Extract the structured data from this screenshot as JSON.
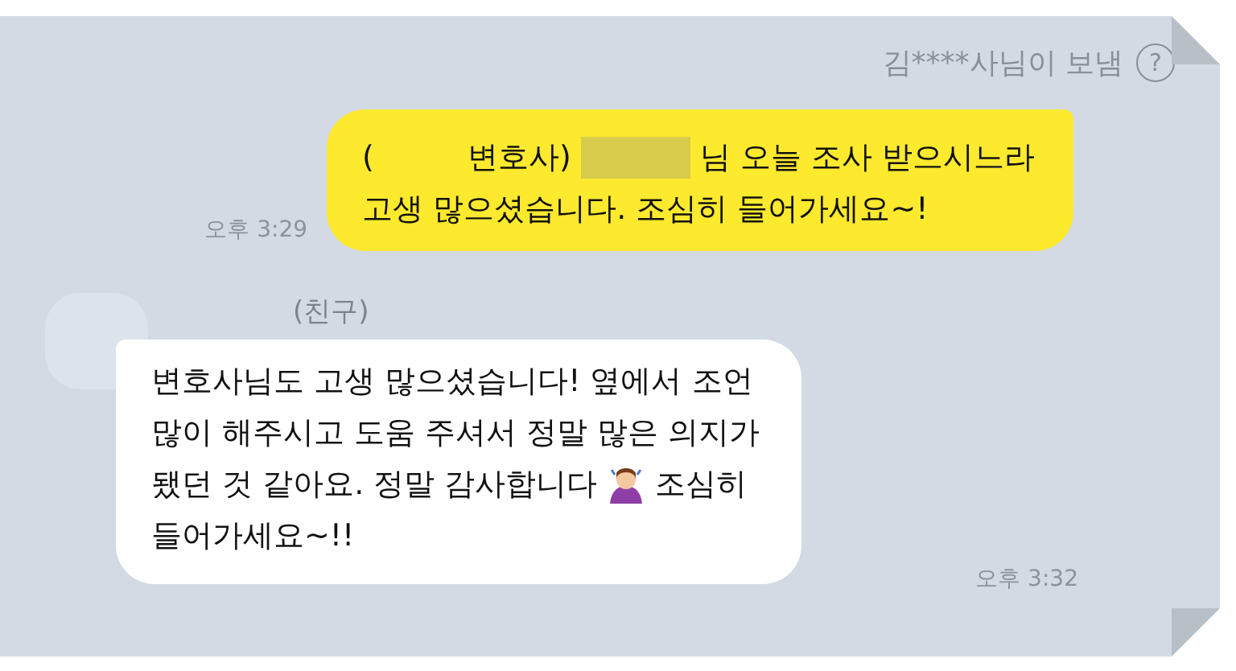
{
  "header": {
    "sender_note": "김****사님이 보냄",
    "help": "?"
  },
  "messages": [
    {
      "kind": "sent",
      "time": "오후 3:29",
      "lines": [
        [
          {
            "kind": "text",
            "text": "("
          },
          {
            "kind": "blank"
          },
          {
            "kind": "text",
            "text": "변호사)"
          },
          {
            "kind": "redacted"
          },
          {
            "kind": "text",
            "text": "님 오늘 조사 받으시느라"
          }
        ],
        [
          {
            "kind": "text",
            "text": "고생 많으셨습니다. 조심히 들어가세요~!"
          }
        ]
      ]
    },
    {
      "kind": "received",
      "sender": "(친구)",
      "time": "오후 3:32",
      "lines": [
        [
          {
            "kind": "text",
            "text": "변호사님도 고생 많으셨습니다! 옆에서 조언"
          }
        ],
        [
          {
            "kind": "text",
            "text": "많이 해주시고 도움 주셔서 정말 많은 의지가"
          }
        ],
        [
          {
            "kind": "text",
            "text": "됐던 것 같아요. 정말 감사합니다"
          },
          {
            "kind": "emoji"
          },
          {
            "kind": "text",
            "text": "조심히"
          }
        ],
        [
          {
            "kind": "text",
            "text": "들어가세요~!!"
          }
        ]
      ]
    }
  ]
}
